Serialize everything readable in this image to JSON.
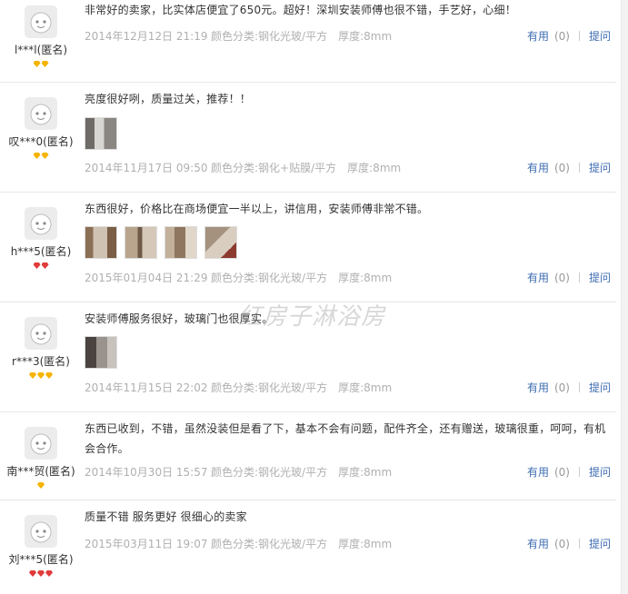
{
  "reviews": [
    {
      "username": "l***l(匿名)",
      "content": "非常好的卖家，比实体店便宜了650元。超好！深圳安装师傅也很不错，手艺好，心细！",
      "date": "2014年12月12日 21:19",
      "sku": "颜色分类:钢化光玻/平方　厚度:8mm",
      "useful_label": "有用",
      "useful_count": "(0)",
      "reply_label": "提问",
      "badge_color": "#f5b400",
      "photos": []
    },
    {
      "username": "叹***0(匿名)",
      "content": "亮度很好咧，质量过关，推荐！！",
      "date": "2014年11月17日 09:50",
      "sku": "颜色分类:钢化+贴膜/平方　厚度:8mm",
      "useful_label": "有用",
      "useful_count": "(0)",
      "reply_label": "提问",
      "badge_color": "#f5b400",
      "photos": [
        "bathroom-photo"
      ]
    },
    {
      "username": "h***5(匿名)",
      "content": "东西很好，价格比在商场便宜一半以上，讲信用，安装师傅非常不错。",
      "date": "2015年01月04日 21:29",
      "sku": "颜色分类:钢化光玻/平方　厚度:8mm",
      "useful_label": "有用",
      "useful_count": "(0)",
      "reply_label": "提问",
      "badge_color": "#e23b3b",
      "photos": [
        "bathroom-photo",
        "bathroom-photo",
        "bathroom-photo",
        "bathroom-photo"
      ]
    },
    {
      "username": "r***3(匿名)",
      "content": "安装师傅服务很好，玻璃门也很厚实。",
      "date": "2014年11月15日 22:02",
      "sku": "颜色分类:钢化光玻/平方　厚度:8mm",
      "useful_label": "有用",
      "useful_count": "(0)",
      "reply_label": "提问",
      "badge_color": "#f5b400",
      "photos": [
        "bathroom-photo"
      ]
    },
    {
      "username": "南***贸(匿名)",
      "content": "东西已收到，不错，虽然没装但是看了下，基本不会有问题，配件齐全，还有赠送，玻璃很重，呵呵，有机会合作。",
      "date": "2014年10月30日 15:57",
      "sku": "颜色分类:钢化光玻/平方　厚度:8mm",
      "useful_label": "有用",
      "useful_count": "(0)",
      "reply_label": "提问",
      "badge_color": "#f5b400",
      "photos": []
    },
    {
      "username": "刘***5(匿名)",
      "content": "质量不错 服务更好 很细心的卖家",
      "date": "2015年03月11日 19:07",
      "sku": "颜色分类:钢化光玻/平方　厚度:8mm",
      "useful_label": "有用",
      "useful_count": "(0)",
      "reply_label": "提问",
      "badge_color": "#e23b3b",
      "photos": []
    }
  ],
  "watermark": "红房子淋浴房"
}
